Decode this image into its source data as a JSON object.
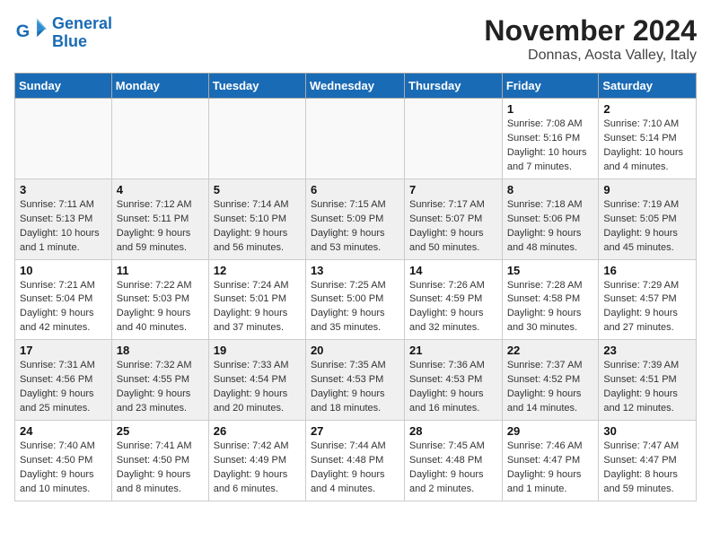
{
  "header": {
    "logo_line1": "General",
    "logo_line2": "Blue",
    "title": "November 2024",
    "subtitle": "Donnas, Aosta Valley, Italy"
  },
  "weekdays": [
    "Sunday",
    "Monday",
    "Tuesday",
    "Wednesday",
    "Thursday",
    "Friday",
    "Saturday"
  ],
  "weeks": [
    [
      {
        "day": "",
        "info": ""
      },
      {
        "day": "",
        "info": ""
      },
      {
        "day": "",
        "info": ""
      },
      {
        "day": "",
        "info": ""
      },
      {
        "day": "",
        "info": ""
      },
      {
        "day": "1",
        "info": "Sunrise: 7:08 AM\nSunset: 5:16 PM\nDaylight: 10 hours and 7 minutes."
      },
      {
        "day": "2",
        "info": "Sunrise: 7:10 AM\nSunset: 5:14 PM\nDaylight: 10 hours and 4 minutes."
      }
    ],
    [
      {
        "day": "3",
        "info": "Sunrise: 7:11 AM\nSunset: 5:13 PM\nDaylight: 10 hours and 1 minute."
      },
      {
        "day": "4",
        "info": "Sunrise: 7:12 AM\nSunset: 5:11 PM\nDaylight: 9 hours and 59 minutes."
      },
      {
        "day": "5",
        "info": "Sunrise: 7:14 AM\nSunset: 5:10 PM\nDaylight: 9 hours and 56 minutes."
      },
      {
        "day": "6",
        "info": "Sunrise: 7:15 AM\nSunset: 5:09 PM\nDaylight: 9 hours and 53 minutes."
      },
      {
        "day": "7",
        "info": "Sunrise: 7:17 AM\nSunset: 5:07 PM\nDaylight: 9 hours and 50 minutes."
      },
      {
        "day": "8",
        "info": "Sunrise: 7:18 AM\nSunset: 5:06 PM\nDaylight: 9 hours and 48 minutes."
      },
      {
        "day": "9",
        "info": "Sunrise: 7:19 AM\nSunset: 5:05 PM\nDaylight: 9 hours and 45 minutes."
      }
    ],
    [
      {
        "day": "10",
        "info": "Sunrise: 7:21 AM\nSunset: 5:04 PM\nDaylight: 9 hours and 42 minutes."
      },
      {
        "day": "11",
        "info": "Sunrise: 7:22 AM\nSunset: 5:03 PM\nDaylight: 9 hours and 40 minutes."
      },
      {
        "day": "12",
        "info": "Sunrise: 7:24 AM\nSunset: 5:01 PM\nDaylight: 9 hours and 37 minutes."
      },
      {
        "day": "13",
        "info": "Sunrise: 7:25 AM\nSunset: 5:00 PM\nDaylight: 9 hours and 35 minutes."
      },
      {
        "day": "14",
        "info": "Sunrise: 7:26 AM\nSunset: 4:59 PM\nDaylight: 9 hours and 32 minutes."
      },
      {
        "day": "15",
        "info": "Sunrise: 7:28 AM\nSunset: 4:58 PM\nDaylight: 9 hours and 30 minutes."
      },
      {
        "day": "16",
        "info": "Sunrise: 7:29 AM\nSunset: 4:57 PM\nDaylight: 9 hours and 27 minutes."
      }
    ],
    [
      {
        "day": "17",
        "info": "Sunrise: 7:31 AM\nSunset: 4:56 PM\nDaylight: 9 hours and 25 minutes."
      },
      {
        "day": "18",
        "info": "Sunrise: 7:32 AM\nSunset: 4:55 PM\nDaylight: 9 hours and 23 minutes."
      },
      {
        "day": "19",
        "info": "Sunrise: 7:33 AM\nSunset: 4:54 PM\nDaylight: 9 hours and 20 minutes."
      },
      {
        "day": "20",
        "info": "Sunrise: 7:35 AM\nSunset: 4:53 PM\nDaylight: 9 hours and 18 minutes."
      },
      {
        "day": "21",
        "info": "Sunrise: 7:36 AM\nSunset: 4:53 PM\nDaylight: 9 hours and 16 minutes."
      },
      {
        "day": "22",
        "info": "Sunrise: 7:37 AM\nSunset: 4:52 PM\nDaylight: 9 hours and 14 minutes."
      },
      {
        "day": "23",
        "info": "Sunrise: 7:39 AM\nSunset: 4:51 PM\nDaylight: 9 hours and 12 minutes."
      }
    ],
    [
      {
        "day": "24",
        "info": "Sunrise: 7:40 AM\nSunset: 4:50 PM\nDaylight: 9 hours and 10 minutes."
      },
      {
        "day": "25",
        "info": "Sunrise: 7:41 AM\nSunset: 4:50 PM\nDaylight: 9 hours and 8 minutes."
      },
      {
        "day": "26",
        "info": "Sunrise: 7:42 AM\nSunset: 4:49 PM\nDaylight: 9 hours and 6 minutes."
      },
      {
        "day": "27",
        "info": "Sunrise: 7:44 AM\nSunset: 4:48 PM\nDaylight: 9 hours and 4 minutes."
      },
      {
        "day": "28",
        "info": "Sunrise: 7:45 AM\nSunset: 4:48 PM\nDaylight: 9 hours and 2 minutes."
      },
      {
        "day": "29",
        "info": "Sunrise: 7:46 AM\nSunset: 4:47 PM\nDaylight: 9 hours and 1 minute."
      },
      {
        "day": "30",
        "info": "Sunrise: 7:47 AM\nSunset: 4:47 PM\nDaylight: 8 hours and 59 minutes."
      }
    ]
  ]
}
